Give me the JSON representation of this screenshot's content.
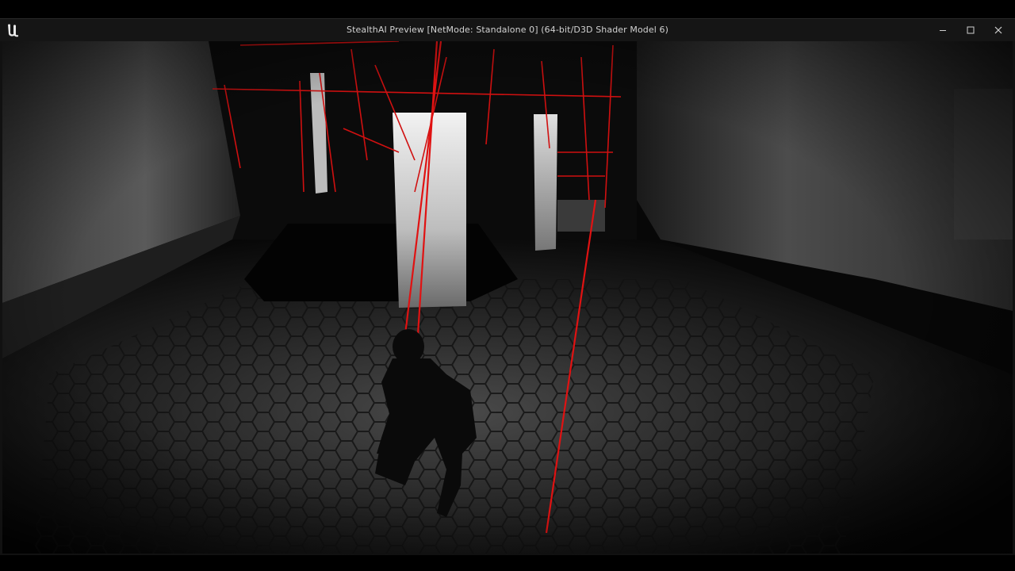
{
  "window": {
    "title": "StealthAI Preview [NetMode: Standalone 0]  (64-bit/D3D Shader Model 6)",
    "logo_icon": "unreal-engine-logo-icon",
    "controls": {
      "minimize_icon": "minimize-icon",
      "maximize_icon": "maximize-icon",
      "close_icon": "close-icon"
    }
  },
  "viewport": {
    "scene": "game-viewport",
    "debug_line_color": "#d01010",
    "floor_color": "#2b2b2b",
    "pillar_color": "#e6e6e6"
  }
}
